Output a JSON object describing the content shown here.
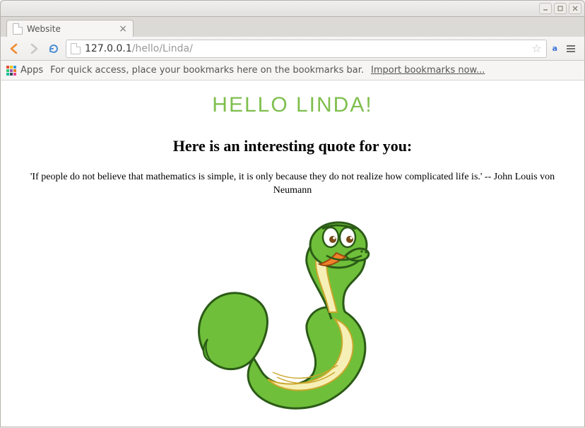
{
  "window": {
    "tab_title": "Website"
  },
  "toolbar": {
    "url_host": "127.0.0.1",
    "url_path": "/hello/Linda/"
  },
  "bookmarks": {
    "apps_label": "Apps",
    "hint": "For quick access, place your bookmarks here on the bookmarks bar.",
    "import_link": "Import bookmarks now..."
  },
  "page": {
    "heading": "Hello Linda!",
    "subheading": "Here is an interesting quote for you:",
    "quote": "'If people do not believe that mathematics is simple, it is only because they do not realize how complicated life is.' -- John Louis von Neumann"
  }
}
